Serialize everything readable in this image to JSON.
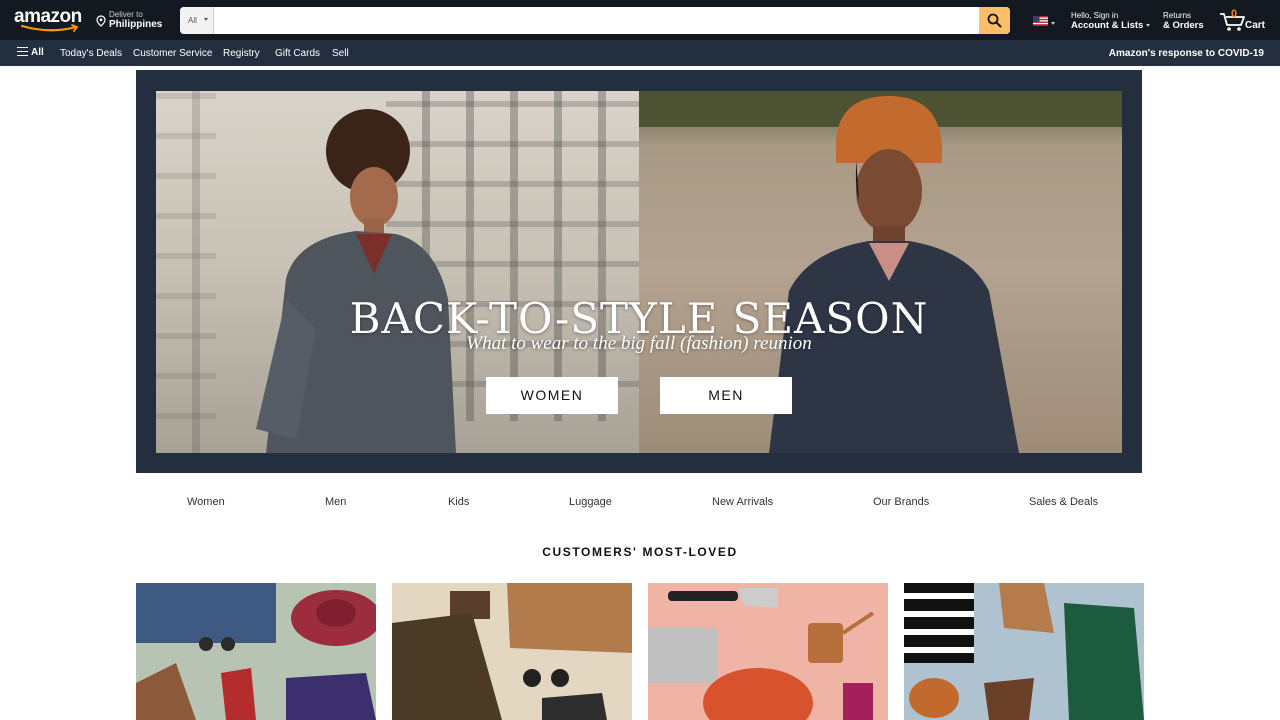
{
  "header": {
    "logo_text": "amazon",
    "deliver_line1": "Deliver to",
    "deliver_line2": "Philippines",
    "search_dept": "All",
    "search_placeholder": "",
    "account_line1": "Hello, Sign in",
    "account_line2": "Account & Lists",
    "orders_line1": "Returns",
    "orders_line2": "& Orders",
    "cart_count": "0",
    "cart_label": "Cart",
    "colors": {
      "nav_bg": "#131921",
      "subnav_bg": "#232f3e",
      "search_button": "#febd69",
      "cart_count": "#f08804"
    }
  },
  "subnav": {
    "all_label": "All",
    "items": [
      "Today's Deals",
      "Customer Service",
      "Registry",
      "Gift Cards",
      "Sell"
    ],
    "covid_label": "Amazon's response to COVID-19"
  },
  "hero": {
    "title": "BACK-TO-STYLE SEASON",
    "subtitle": "What to wear to the big fall (fashion) reunion",
    "buttons": [
      "WOMEN",
      "MEN"
    ]
  },
  "categories": [
    "Women",
    "Men",
    "Kids",
    "Luggage",
    "New Arrivals",
    "Our Brands",
    "Sales & Deals"
  ],
  "section_title": "CUSTOMERS' MOST-LOVED",
  "tiles": [
    {
      "theme": "womens-flatlay-sage"
    },
    {
      "theme": "mens-flatlay-beige"
    },
    {
      "theme": "home-kitchen-pink"
    },
    {
      "theme": "womens-flatlay-blue"
    }
  ]
}
